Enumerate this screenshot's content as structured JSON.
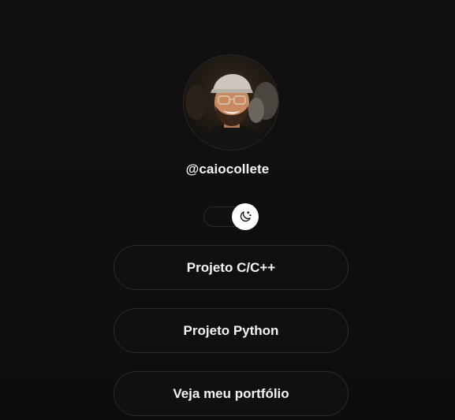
{
  "profile": {
    "handle": "@caiocollete"
  },
  "theme_toggle": {
    "icon": "moon-sparkle-icon",
    "state": "dark"
  },
  "links": [
    {
      "label": "Projeto C/C++"
    },
    {
      "label": "Projeto Python"
    },
    {
      "label": "Veja meu portfólio"
    }
  ],
  "colors": {
    "background": "#111111",
    "button_border": "#2a2a2a",
    "text": "#f3f3f3",
    "toggle_knob": "#ffffff"
  }
}
